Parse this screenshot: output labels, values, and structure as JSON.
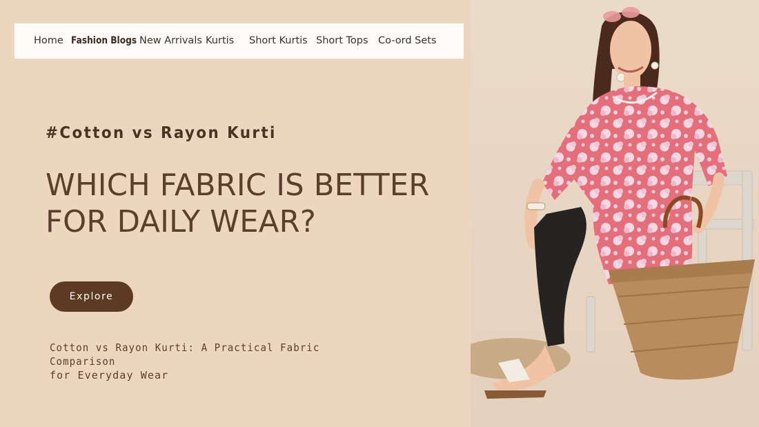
{
  "nav": {
    "items": [
      {
        "label": "Home",
        "active": false
      },
      {
        "label": "Fashion Blogs",
        "active": true
      },
      {
        "label": "New Arrivals",
        "active": false
      },
      {
        "label": "Kurtis",
        "active": false
      },
      {
        "label": "Short Kurtis",
        "active": false
      },
      {
        "label": "Short Tops",
        "active": false
      },
      {
        "label": "Co-ord Sets",
        "active": false
      }
    ]
  },
  "hero": {
    "tagline": "#Cotton vs Rayon Kurti",
    "headline_line1": "WHICH FABRIC IS BETTER",
    "headline_line2": "FOR DAILY WEAR?",
    "cta_label": "Explore",
    "subtitle_line1": "Cotton vs Rayon Kurti: A Practical Fabric Comparison",
    "subtitle_line2": "for Everyday Wear"
  },
  "colors": {
    "background": "#ecd6c0",
    "nav_background": "#fdfbf8",
    "brand_brown": "#5c3b22",
    "text_brown": "#5a3f2b",
    "kurti_pink": "#e46f7b"
  }
}
